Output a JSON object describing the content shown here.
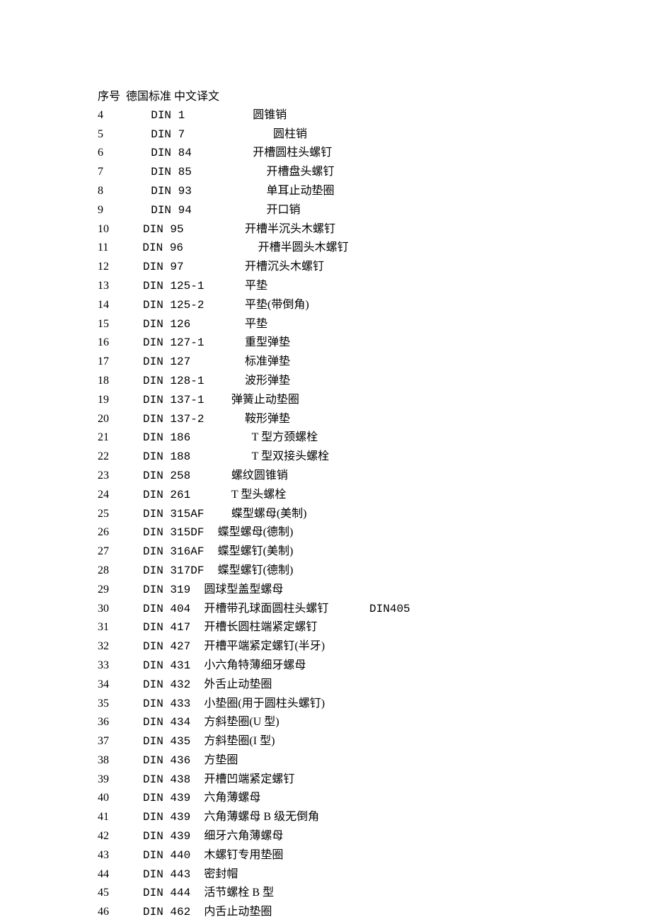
{
  "header": {
    "col1": "序号",
    "col2": "德国标准",
    "col3": "中文译文"
  },
  "rows": [
    {
      "seq": "4",
      "std": "       DIN 1          ",
      "desc": "圆锥销"
    },
    {
      "seq": "5",
      "std": "       DIN 7             ",
      "desc": "圆柱销"
    },
    {
      "seq": "6",
      "std": "       DIN 84         ",
      "desc": "开槽圆柱头螺钉"
    },
    {
      "seq": "7",
      "std": "       DIN 85           ",
      "desc": "开槽盘头螺钉"
    },
    {
      "seq": "8",
      "std": "       DIN 93           ",
      "desc": "单耳止动垫圈"
    },
    {
      "seq": "9",
      "std": "       DIN 94           ",
      "desc": "开口销"
    },
    {
      "seq": "10",
      "std": "     DIN 95         ",
      "desc": "开槽半沉头木螺钉"
    },
    {
      "seq": "11",
      "std": "     DIN 96           ",
      "desc": "开槽半圆头木螺钉"
    },
    {
      "seq": "12",
      "std": "     DIN 97         ",
      "desc": "开槽沉头木螺钉"
    },
    {
      "seq": "13",
      "std": "     DIN 125-1      ",
      "desc": "平垫"
    },
    {
      "seq": "14",
      "std": "     DIN 125-2      ",
      "desc": "平垫(带倒角)"
    },
    {
      "seq": "15",
      "std": "     DIN 126        ",
      "desc": "平垫"
    },
    {
      "seq": "16",
      "std": "     DIN 127-1      ",
      "desc": "重型弹垫"
    },
    {
      "seq": "17",
      "std": "     DIN 127        ",
      "desc": "标准弹垫"
    },
    {
      "seq": "18",
      "std": "     DIN 128-1      ",
      "desc": "波形弹垫"
    },
    {
      "seq": "19",
      "std": "     DIN 137-1    ",
      "desc": "弹簧止动垫圈"
    },
    {
      "seq": "20",
      "std": "     DIN 137-2      ",
      "desc": "鞍形弹垫"
    },
    {
      "seq": "21",
      "std": "     DIN 186         ",
      "desc": "T 型方颈螺栓"
    },
    {
      "seq": "22",
      "std": "     DIN 188         ",
      "desc": "T 型双接头螺栓"
    },
    {
      "seq": "23",
      "std": "     DIN 258      ",
      "desc": "螺纹圆锥销"
    },
    {
      "seq": "24",
      "std": "     DIN 261      ",
      "desc": "T 型头螺栓"
    },
    {
      "seq": "25",
      "std": "     DIN 315AF    ",
      "desc": "蝶型螺母(美制)"
    },
    {
      "seq": "26",
      "std": "     DIN 315DF  ",
      "desc": "蝶型螺母(德制)"
    },
    {
      "seq": "27",
      "std": "     DIN 316AF  ",
      "desc": "蝶型螺钉(美制)"
    },
    {
      "seq": "28",
      "std": "     DIN 317DF  ",
      "desc": "蝶型螺钉(德制)"
    },
    {
      "seq": "29",
      "std": "     DIN 319  ",
      "desc": "圆球型盖型螺母"
    },
    {
      "seq": "30",
      "std": "     DIN 404  ",
      "desc": "开槽带孔球面圆柱头螺钉",
      "extra": "      DIN405"
    },
    {
      "seq": "31",
      "std": "     DIN 417  ",
      "desc": "开槽长圆柱端紧定螺钉"
    },
    {
      "seq": "32",
      "std": "     DIN 427  ",
      "desc": "开槽平端紧定螺钉(半牙)"
    },
    {
      "seq": "33",
      "std": "     DIN 431  ",
      "desc": "小六角特薄细牙螺母"
    },
    {
      "seq": "34",
      "std": "     DIN 432  ",
      "desc": "外舌止动垫圈"
    },
    {
      "seq": "35",
      "std": "     DIN 433  ",
      "desc": "小垫圈(用于圆柱头螺钉)"
    },
    {
      "seq": "36",
      "std": "     DIN 434  ",
      "desc": "方斜垫圈(U 型)"
    },
    {
      "seq": "37",
      "std": "     DIN 435  ",
      "desc": "方斜垫圈(I 型)"
    },
    {
      "seq": "38",
      "std": "     DIN 436  ",
      "desc": "方垫圈"
    },
    {
      "seq": "39",
      "std": "     DIN 438  ",
      "desc": "开槽凹端紧定螺钉"
    },
    {
      "seq": "40",
      "std": "     DIN 439  ",
      "desc": "六角薄螺母"
    },
    {
      "seq": "41",
      "std": "     DIN 439  ",
      "desc": "六角薄螺母 B 级无倒角"
    },
    {
      "seq": "42",
      "std": "     DIN 439  ",
      "desc": "细牙六角薄螺母"
    },
    {
      "seq": "43",
      "std": "     DIN 440  ",
      "desc": "木螺钉专用垫圈"
    },
    {
      "seq": "44",
      "std": "     DIN 443  ",
      "desc": "密封帽"
    },
    {
      "seq": "45",
      "std": "     DIN 444  ",
      "desc": "活节螺栓 B 型"
    },
    {
      "seq": "46",
      "std": "     DIN 462  ",
      "desc": "内舌止动垫圈"
    }
  ]
}
